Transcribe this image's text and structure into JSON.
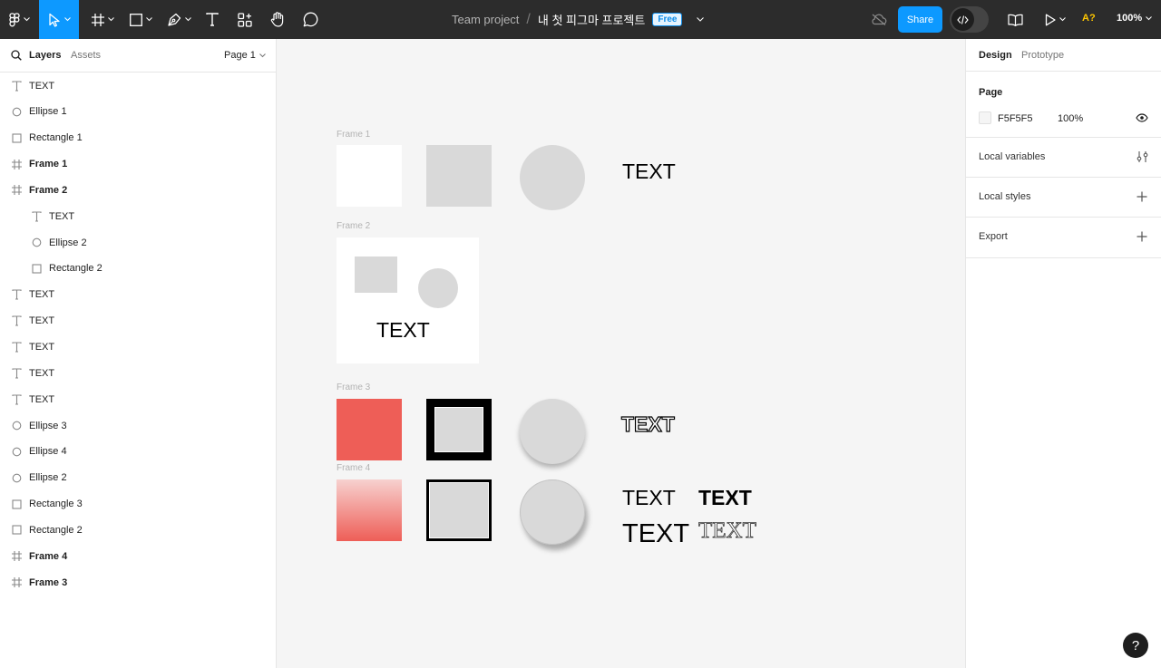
{
  "toolbar": {
    "team": "Team project",
    "slash": "/",
    "file_name": "내 첫 피그마 프로젝트",
    "plan_badge": "Free",
    "share_label": "Share",
    "avatar_initial": "A?",
    "zoom": "100%"
  },
  "left_panel": {
    "tab_layers": "Layers",
    "tab_assets": "Assets",
    "page_selector": "Page 1",
    "layers": [
      {
        "label": "TEXT",
        "icon": "text-icon",
        "indent": false,
        "frame": false
      },
      {
        "label": "Ellipse 1",
        "icon": "ellipse-icon",
        "indent": false,
        "frame": false
      },
      {
        "label": "Rectangle 1",
        "icon": "rectangle-icon",
        "indent": false,
        "frame": false
      },
      {
        "label": "Frame 1",
        "icon": "frame-icon",
        "indent": false,
        "frame": true
      },
      {
        "label": "Frame 2",
        "icon": "frame-icon",
        "indent": false,
        "frame": true
      },
      {
        "label": "TEXT",
        "icon": "text-icon",
        "indent": true,
        "frame": false
      },
      {
        "label": "Ellipse 2",
        "icon": "ellipse-icon",
        "indent": true,
        "frame": false
      },
      {
        "label": "Rectangle 2",
        "icon": "rectangle-icon",
        "indent": true,
        "frame": false
      },
      {
        "label": "TEXT",
        "icon": "text-icon",
        "indent": false,
        "frame": false
      },
      {
        "label": "TEXT",
        "icon": "text-icon",
        "indent": false,
        "frame": false
      },
      {
        "label": "TEXT",
        "icon": "text-icon",
        "indent": false,
        "frame": false
      },
      {
        "label": "TEXT",
        "icon": "text-icon",
        "indent": false,
        "frame": false
      },
      {
        "label": "TEXT",
        "icon": "text-icon",
        "indent": false,
        "frame": false
      },
      {
        "label": "Ellipse 3",
        "icon": "ellipse-icon",
        "indent": false,
        "frame": false
      },
      {
        "label": "Ellipse 4",
        "icon": "ellipse-icon",
        "indent": false,
        "frame": false
      },
      {
        "label": "Ellipse 2",
        "icon": "ellipse-icon",
        "indent": false,
        "frame": false
      },
      {
        "label": "Rectangle 3",
        "icon": "rectangle-icon",
        "indent": false,
        "frame": false
      },
      {
        "label": "Rectangle 2",
        "icon": "rectangle-icon",
        "indent": false,
        "frame": false
      },
      {
        "label": "Frame 4",
        "icon": "frame-icon",
        "indent": false,
        "frame": true
      },
      {
        "label": "Frame 3",
        "icon": "frame-icon",
        "indent": false,
        "frame": true
      }
    ]
  },
  "right_panel": {
    "tab_design": "Design",
    "tab_prototype": "Prototype",
    "page_title": "Page",
    "page_color": "F5F5F5",
    "page_opacity": "100%",
    "local_variables": "Local variables",
    "local_styles": "Local styles",
    "export": "Export",
    "help": "?"
  },
  "canvas": {
    "frame1_label": "Frame 1",
    "frame2_label": "Frame 2",
    "frame3_label": "Frame 3",
    "frame4_label": "Frame 4",
    "text": "TEXT"
  },
  "colors": {
    "accent": "#0d99ff",
    "toolbar_bg": "#2c2c2c",
    "canvas_bg": "#f5f5f5",
    "red_fill": "#ee5e57",
    "shape_gray": "#d9d9d9"
  }
}
